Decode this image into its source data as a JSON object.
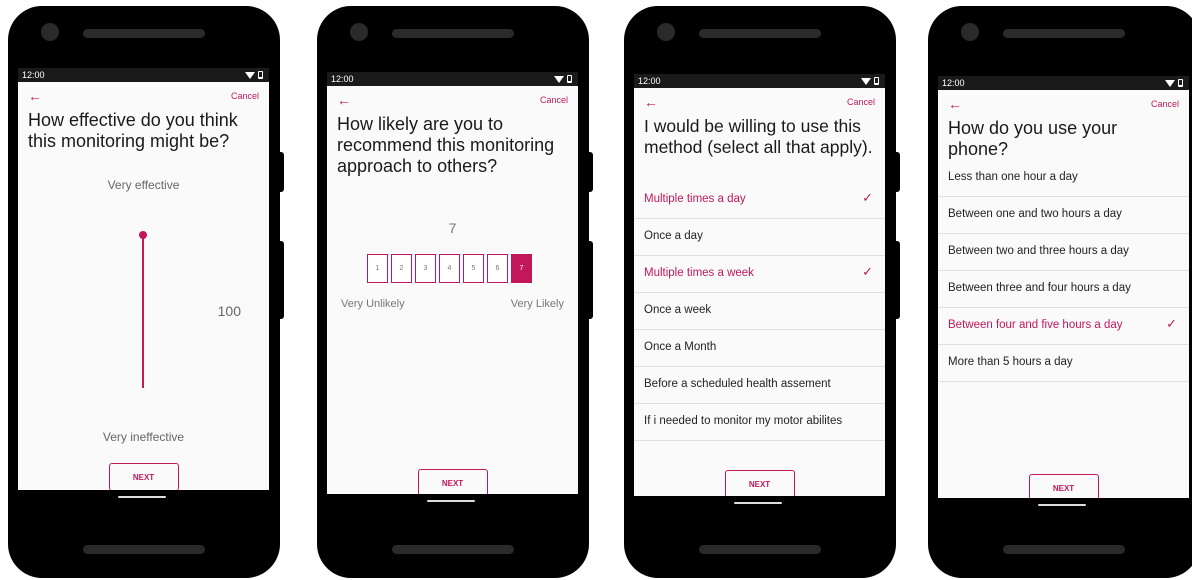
{
  "status_time": "12:00",
  "back_symbol": "←",
  "cancel_label": "Cancel",
  "next_label": "NEXT",
  "check_symbol": "✓",
  "accent_color": "#c2185b",
  "screen1": {
    "question": "How effective do you think this monitoring might be?",
    "top_label": "Very effective",
    "bottom_label": "Very ineffective",
    "slider_value": "100",
    "slider_level": 1.0
  },
  "screen2": {
    "question": "How likely are you to recommend this monitoring approach to others?",
    "selected_value": "7",
    "scale": [
      "1",
      "2",
      "3",
      "4",
      "5",
      "6",
      "7"
    ],
    "left_label": "Very Unlikely",
    "right_label": "Very Likely"
  },
  "screen3": {
    "question": "I would be willing to use this method (select all that apply).",
    "options": [
      {
        "label": "Multiple times a day",
        "selected": true
      },
      {
        "label": "Once a day",
        "selected": false
      },
      {
        "label": "Multiple times a week",
        "selected": true
      },
      {
        "label": "Once a week",
        "selected": false
      },
      {
        "label": "Once a Month",
        "selected": false
      },
      {
        "label": "Before a scheduled health assement",
        "selected": false
      },
      {
        "label": "If i needed to monitor my motor abilites",
        "selected": false
      }
    ]
  },
  "screen4": {
    "question": "How do you use your phone?",
    "options": [
      {
        "label": "Less than one hour a day",
        "selected": false
      },
      {
        "label": "Between one and two hours a day",
        "selected": false
      },
      {
        "label": "Between two and three hours a day",
        "selected": false
      },
      {
        "label": "Between three and four hours a day",
        "selected": false
      },
      {
        "label": "Between four and five hours a day",
        "selected": true
      },
      {
        "label": "More than 5 hours a day",
        "selected": false
      }
    ]
  }
}
